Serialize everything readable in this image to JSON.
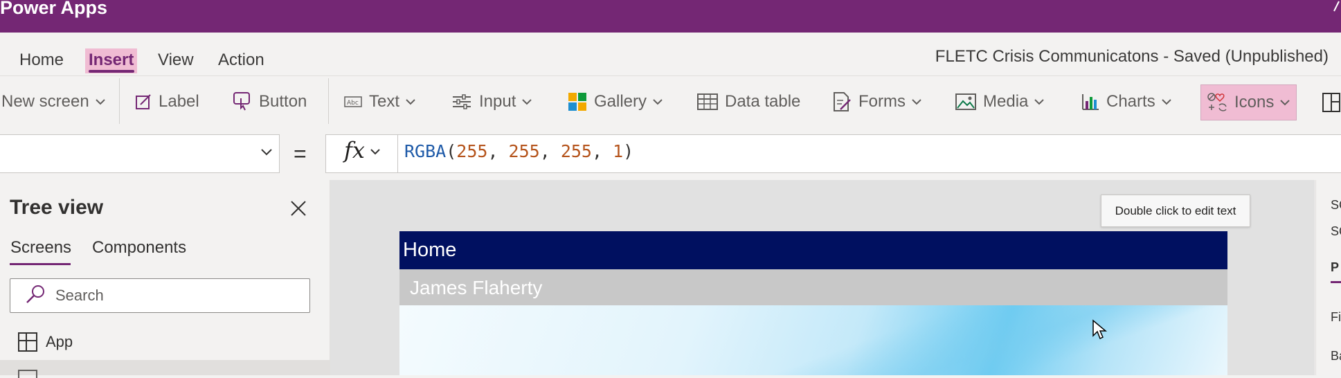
{
  "app": {
    "title": "Power Apps"
  },
  "menu": {
    "items": [
      "Home",
      "Insert",
      "View",
      "Action"
    ],
    "document_title": "FLETC Crisis Communicatons - Saved (Unpublished)"
  },
  "ribbon": {
    "new_screen": "New screen",
    "label": "Label",
    "button": "Button",
    "text": "Text",
    "input": "Input",
    "gallery": "Gallery",
    "data_table": "Data table",
    "forms": "Forms",
    "media": "Media",
    "charts": "Charts",
    "icons": "Icons"
  },
  "formula": {
    "property_value": "",
    "equals": "=",
    "fx": "fx",
    "fn": "RGBA",
    "open": "(",
    "r": "255",
    "g": "255",
    "b": "255",
    "a": "1",
    "sep": ", ",
    "close": ")"
  },
  "tree": {
    "title": "Tree view",
    "tabs": [
      "Screens",
      "Components"
    ],
    "search_placeholder": "Search",
    "items": [
      "App"
    ]
  },
  "canvas": {
    "tooltip": "Double click to edit text",
    "header": "Home",
    "user_name": "James Flaherty"
  },
  "right_panel": {
    "fragments": [
      "SC",
      "SC",
      "P",
      "Fi",
      "Ba"
    ]
  },
  "colors": {
    "brand": "#742774",
    "highlight": "#f0bcd3",
    "header_bar": "#001060"
  },
  "icons": [
    "label-icon",
    "button-icon",
    "text-icon",
    "input-icon",
    "gallery-icon",
    "data-table-icon",
    "forms-icon",
    "media-icon",
    "charts-icon",
    "icons-icon",
    "close-icon",
    "search-icon",
    "app-icon",
    "cursor-icon"
  ]
}
